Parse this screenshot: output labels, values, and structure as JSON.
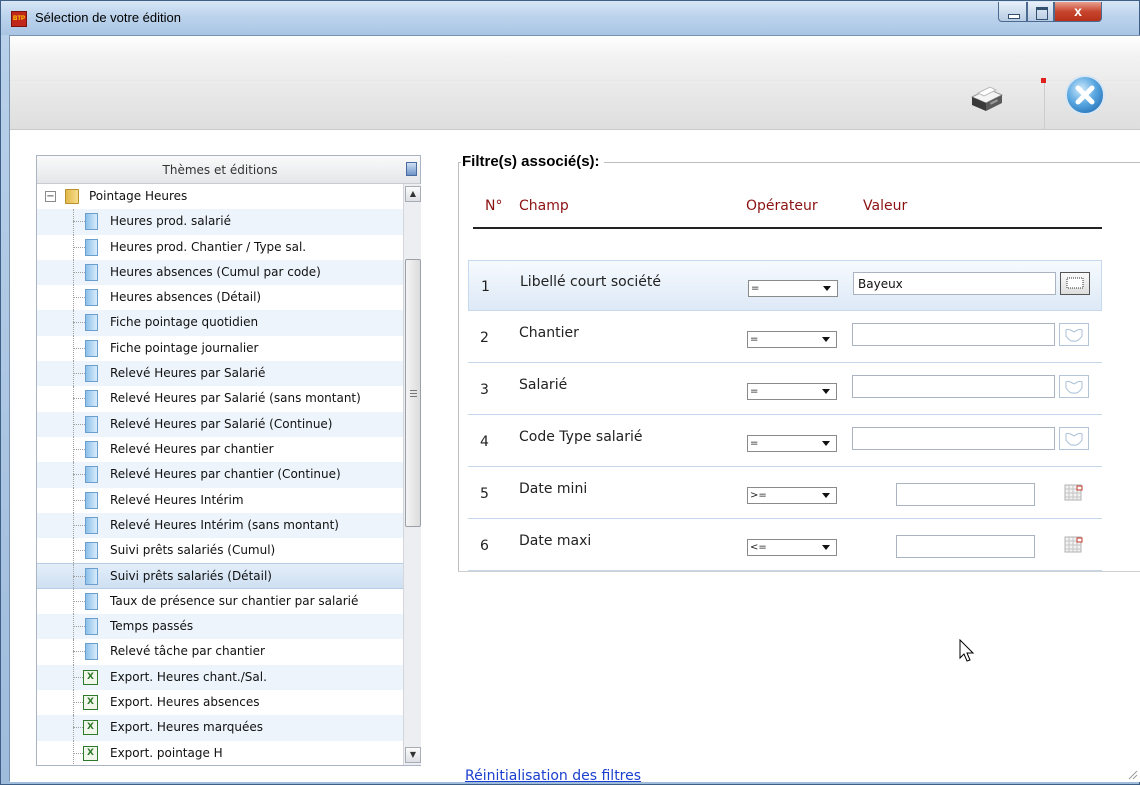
{
  "window": {
    "title": "Sélection de votre édition",
    "app_icon_label": "BTP",
    "close_glyph": "x"
  },
  "toolbar": {
    "print_icon": "printer-icon",
    "close_icon": "close-circle-icon"
  },
  "tree": {
    "header": "Thèmes et éditions",
    "root": {
      "label": "Pointage Heures",
      "toggle": "−"
    },
    "items": [
      {
        "label": "Heures prod. salarié",
        "icon": "doc"
      },
      {
        "label": "Heures prod. Chantier / Type sal.",
        "icon": "doc"
      },
      {
        "label": "Heures absences (Cumul par code)",
        "icon": "doc"
      },
      {
        "label": "Heures absences (Détail)",
        "icon": "doc"
      },
      {
        "label": "Fiche pointage quotidien",
        "icon": "doc"
      },
      {
        "label": "Fiche pointage journalier",
        "icon": "doc"
      },
      {
        "label": "Relevé Heures par Salarié",
        "icon": "doc"
      },
      {
        "label": "Relevé Heures par Salarié (sans montant)",
        "icon": "doc"
      },
      {
        "label": "Relevé Heures par Salarié (Continue)",
        "icon": "doc"
      },
      {
        "label": "Relevé Heures par chantier",
        "icon": "doc"
      },
      {
        "label": "Relevé Heures par chantier (Continue)",
        "icon": "doc"
      },
      {
        "label": "Relevé Heures Intérim",
        "icon": "doc"
      },
      {
        "label": "Relevé Heures Intérim (sans montant)",
        "icon": "doc"
      },
      {
        "label": "Suivi prêts salariés (Cumul)",
        "icon": "doc"
      },
      {
        "label": "Suivi prêts salariés (Détail)",
        "icon": "doc",
        "selected": true
      },
      {
        "label": "Taux de présence sur chantier par salarié",
        "icon": "doc"
      },
      {
        "label": "Temps passés",
        "icon": "doc"
      },
      {
        "label": "Relevé tâche par chantier",
        "icon": "doc"
      },
      {
        "label": "Export. Heures chant./Sal.",
        "icon": "xls"
      },
      {
        "label": "Export. Heures absences",
        "icon": "xls"
      },
      {
        "label": "Export. Heures marquées",
        "icon": "xls"
      },
      {
        "label": "Export. pointage H",
        "icon": "xls"
      }
    ],
    "xls_glyph": "X",
    "scroll_up": "▲",
    "scroll_down": "▼"
  },
  "filters": {
    "title": "Filtre(s) associé(s):",
    "columns": {
      "num": "N°",
      "field": "Champ",
      "operator": "Opérateur",
      "value": "Valeur"
    },
    "rows": [
      {
        "num": "1",
        "field": "Libellé court société",
        "operator": "=",
        "value": "Bayeux",
        "kind": "lookup",
        "active": true
      },
      {
        "num": "2",
        "field": "Chantier",
        "operator": "=",
        "value": "",
        "kind": "lookup"
      },
      {
        "num": "3",
        "field": "Salarié",
        "operator": "=",
        "value": "",
        "kind": "lookup"
      },
      {
        "num": "4",
        "field": "Code Type salarié",
        "operator": "=",
        "value": "",
        "kind": "lookup"
      },
      {
        "num": "5",
        "field": "Date mini",
        "operator": ">=",
        "value": "",
        "kind": "date"
      },
      {
        "num": "6",
        "field": "Date maxi",
        "operator": "<=",
        "value": "",
        "kind": "date"
      }
    ],
    "reset_link": "Réinitialisation des filtres"
  },
  "colors": {
    "column_header": "#8b1212",
    "link": "#1b3fcf",
    "selected_row": "#cfe0f2"
  }
}
